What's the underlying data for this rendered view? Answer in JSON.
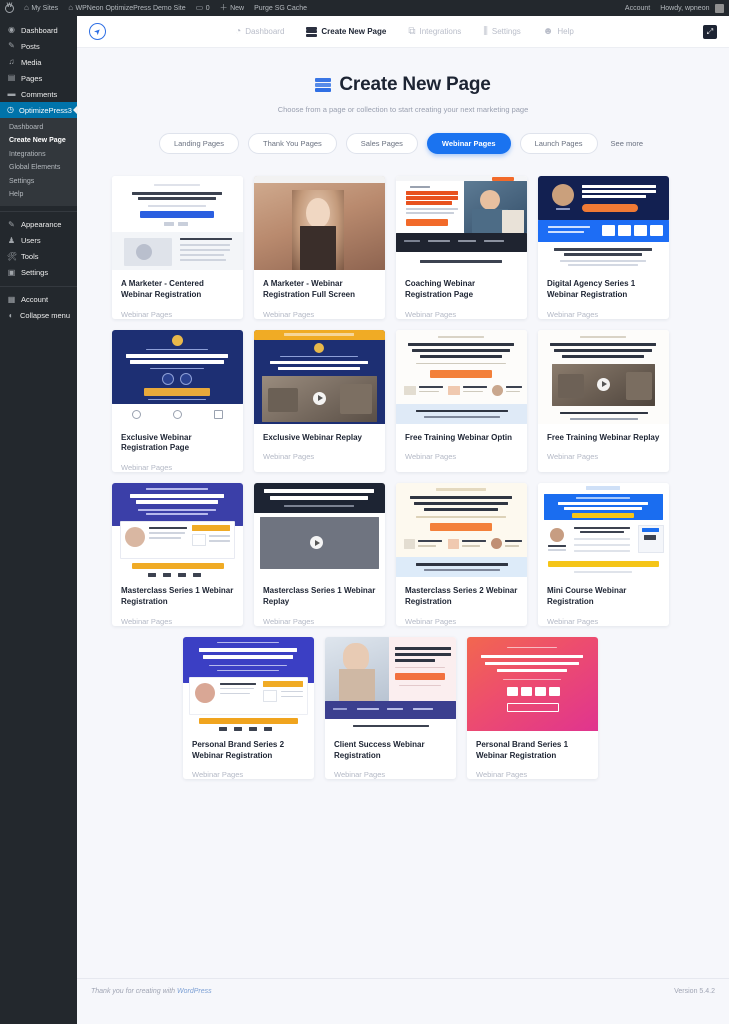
{
  "adminbar": {
    "wp_logo": "wordpress-logo",
    "items": [
      {
        "icon": "sites-icon",
        "label": "My Sites"
      },
      {
        "icon": "site-icon",
        "label": "WPNeon OptimizePress Demo Site"
      },
      {
        "icon": "comment-icon",
        "label": "0"
      },
      {
        "icon": "plus-icon",
        "label": "New"
      },
      {
        "icon": "",
        "label": "Purge SG Cache"
      }
    ],
    "right": [
      {
        "label": "Account"
      },
      {
        "label": "Howdy, wpneon"
      }
    ]
  },
  "sidebar": {
    "items": [
      {
        "icon": "dashboard-icon",
        "label": "Dashboard"
      },
      {
        "icon": "posts-icon",
        "label": "Posts"
      },
      {
        "icon": "media-icon",
        "label": "Media"
      },
      {
        "icon": "pages-icon",
        "label": "Pages"
      },
      {
        "icon": "comments-icon",
        "label": "Comments"
      },
      {
        "icon": "optimizepress-icon",
        "label": "OptimizePress3"
      }
    ],
    "submenu": [
      {
        "label": "Dashboard",
        "active": false
      },
      {
        "label": "Create New Page",
        "active": true
      },
      {
        "label": "Integrations",
        "active": false
      },
      {
        "label": "Global Elements",
        "active": false
      },
      {
        "label": "Settings",
        "active": false
      },
      {
        "label": "Help",
        "active": false
      }
    ],
    "items2": [
      {
        "icon": "appearance-icon",
        "label": "Appearance"
      },
      {
        "icon": "users-icon",
        "label": "Users"
      },
      {
        "icon": "tools-icon",
        "label": "Tools"
      },
      {
        "icon": "settings-icon",
        "label": "Settings"
      }
    ],
    "items3": [
      {
        "icon": "account-icon",
        "label": "Account"
      },
      {
        "icon": "collapse-icon",
        "label": "Collapse menu"
      }
    ]
  },
  "topnav": {
    "logo": "optimizepress-rocket-logo",
    "items": [
      {
        "label": "Dashboard",
        "icon": "dashboard-icon",
        "active": false
      },
      {
        "label": "Create New Page",
        "icon": "stack-icon",
        "active": true
      },
      {
        "label": "Integrations",
        "icon": "integrations-icon",
        "active": false
      },
      {
        "label": "Settings",
        "icon": "sliders-icon",
        "active": false
      },
      {
        "label": "Help",
        "icon": "lifebuoy-icon",
        "active": false
      }
    ],
    "expand_icon": "expand-icon"
  },
  "header": {
    "title": "Create New Page",
    "title_icon": "stack-icon",
    "subtitle": "Choose from a page or collection to start creating your next marketing page"
  },
  "filters": [
    {
      "label": "Landing Pages",
      "active": false,
      "plain": false
    },
    {
      "label": "Thank You Pages",
      "active": false,
      "plain": false
    },
    {
      "label": "Sales Pages",
      "active": false,
      "plain": false
    },
    {
      "label": "Webinar Pages",
      "active": true,
      "plain": false
    },
    {
      "label": "Launch Pages",
      "active": false,
      "plain": false
    },
    {
      "label": "See more",
      "active": false,
      "plain": true
    }
  ],
  "templates": [
    {
      "title": "A Marketer - Centered Webinar Registration",
      "category": "Webinar Pages",
      "thumb": "light-centered"
    },
    {
      "title": "A Marketer - Webinar Registration Full Screen",
      "category": "Webinar Pages",
      "thumb": "photo-portrait"
    },
    {
      "title": "Coaching Webinar Registration Page",
      "category": "Webinar Pages",
      "thumb": "orange-headline-photo"
    },
    {
      "title": "Digital Agency Series 1 Webinar Registration",
      "category": "Webinar Pages",
      "thumb": "navy-hero"
    },
    {
      "title": "Exclusive Webinar Registration Page",
      "category": "Webinar Pages",
      "thumb": "deep-blue-formula"
    },
    {
      "title": "Exclusive Webinar Replay",
      "category": "Webinar Pages",
      "thumb": "gold-top-video"
    },
    {
      "title": "Free Training Webinar Optin",
      "category": "Webinar Pages",
      "thumb": "white-autopilot"
    },
    {
      "title": "Free Training Webinar Replay",
      "category": "Webinar Pages",
      "thumb": "white-autopilot-video"
    },
    {
      "title": "Masterclass Series 1 Webinar Registration",
      "category": "Webinar Pages",
      "thumb": "blue-masterclass"
    },
    {
      "title": "Masterclass Series 1 Webinar Replay",
      "category": "Webinar Pages",
      "thumb": "dark-video-masterclass"
    },
    {
      "title": "Masterclass Series 2 Webinar Registration",
      "category": "Webinar Pages",
      "thumb": "cream-funnel"
    },
    {
      "title": "Mini Course Webinar Registration",
      "category": "Webinar Pages",
      "thumb": "blue-banner-course"
    },
    {
      "title": "Personal Brand Series 2 Webinar Registration",
      "category": "Webinar Pages",
      "thumb": "indigo-high-converting"
    },
    {
      "title": "Client Success Webinar Registration",
      "category": "Webinar Pages",
      "thumb": "photo-consulting"
    },
    {
      "title": "Personal Brand Series 1 Webinar Registration",
      "category": "Webinar Pages",
      "thumb": "pink-gradient"
    }
  ],
  "footer": {
    "thanks_prefix": "Thank you for creating with ",
    "thanks_link": "WordPress",
    "version": "Version 5.4.2"
  },
  "colors": {
    "accent": "#1a73f0",
    "admin_dark": "#23282d",
    "current_blue": "#0073aa",
    "page_bg": "#f6f7fb"
  }
}
